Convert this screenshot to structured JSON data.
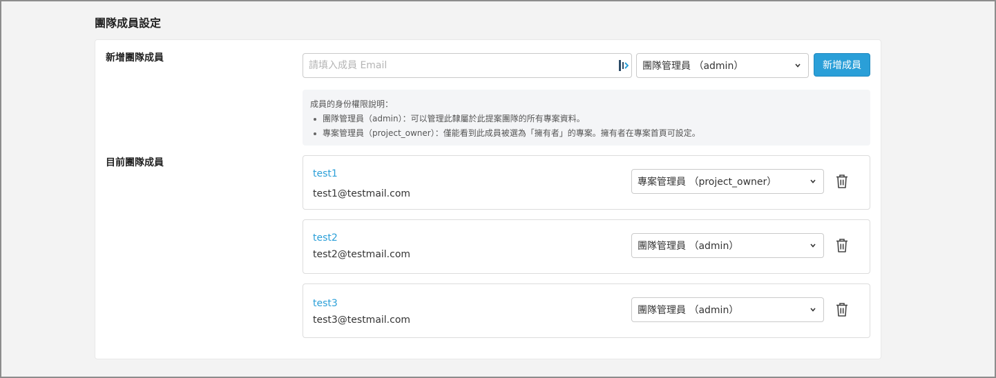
{
  "page": {
    "title": "團隊成員設定"
  },
  "add_section": {
    "label": "新增團隊成員",
    "email_placeholder": "請填入成員 Email",
    "email_value": "",
    "role_select": "團隊管理員 （admin）",
    "add_button": "新增成員"
  },
  "info": {
    "heading": "成員的身份權限說明：",
    "items": [
      "團隊管理員（admin）：可以管理此隸屬於此提案團隊的所有專案資料。",
      "專案管理員（project_owner）：僅能看到此成員被選為「擁有者」的專案。擁有者在專案首頁可設定。"
    ]
  },
  "members_section": {
    "label": "目前團隊成員",
    "members": [
      {
        "name": "test1",
        "email": "test1@testmail.com",
        "role": "專案管理員 （project_owner）"
      },
      {
        "name": "test2",
        "email": "test2@testmail.com",
        "role": "團隊管理員 （admin）"
      },
      {
        "name": "test3",
        "email": "test3@testmail.com",
        "role": "團隊管理員 （admin）"
      }
    ]
  },
  "icons": {
    "chevron": "chevron-down-icon",
    "trash": "trash-icon",
    "password_manager": "password-manager-icon"
  },
  "colors": {
    "accent": "#2a9fd8",
    "link": "#2a9fd8",
    "info_bg": "#f4f5f7"
  }
}
